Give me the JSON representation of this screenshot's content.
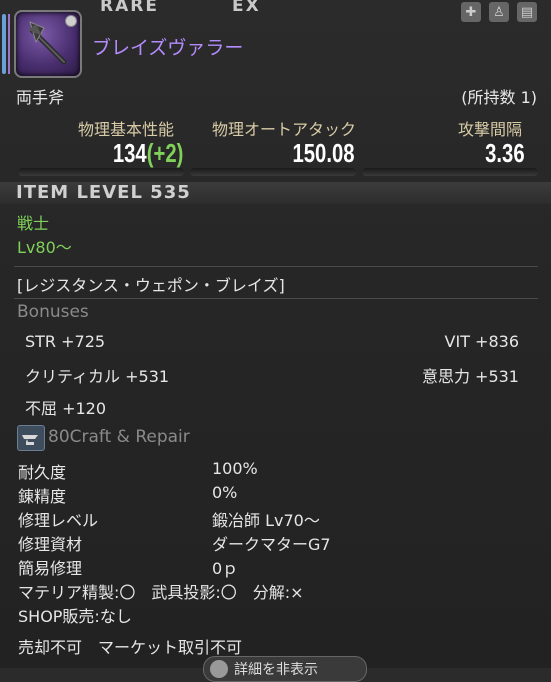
{
  "header": {
    "rarity": "RARE",
    "ex": "EX",
    "item_name": "ブレイズヴァラー",
    "category": "両手斧",
    "owned": "(所持数 1)"
  },
  "stats": [
    {
      "label": "物理基本性能",
      "value": "134",
      "bonus": "(+2)"
    },
    {
      "label": "物理オートアタック",
      "value": "150.08",
      "bonus": ""
    },
    {
      "label": "攻撃間隔",
      "value": "3.36",
      "bonus": ""
    }
  ],
  "item_level": "ITEM LEVEL 535",
  "job": "戦士",
  "level_req": "Lv80～",
  "series": "[レジスタンス・ウェポン・ブレイズ]",
  "bonuses": {
    "heading": "Bonuses",
    "left": [
      "STR +725",
      "クリティカル +531",
      "不屈 +120"
    ],
    "right": [
      "VIT +836",
      "意思力 +531"
    ]
  },
  "craft": {
    "level": "80",
    "label": "Craft & Repair"
  },
  "repair": [
    {
      "label": "耐久度",
      "value": "100%"
    },
    {
      "label": "錬精度",
      "value": "0%"
    },
    {
      "label": "修理レベル",
      "value": "鍛冶師 Lv70～"
    },
    {
      "label": "修理資材",
      "value": "ダークマターG7"
    },
    {
      "label": "簡易修理",
      "value": "0ｐ"
    }
  ],
  "flags_line": "マテリア精製:〇　武具投影:〇　分解:×",
  "shop_line": "SHOP販売:なし",
  "trade_line": "売却不可　マーケット取引不可",
  "bottom_button": "詳細を非表示",
  "icons": [
    "plus-icon",
    "glamour-icon",
    "armoire-icon"
  ],
  "colors": {
    "item_name": "#b58cff",
    "bonus_green": "#7fd15a",
    "stat_label": "#d8cba6"
  }
}
